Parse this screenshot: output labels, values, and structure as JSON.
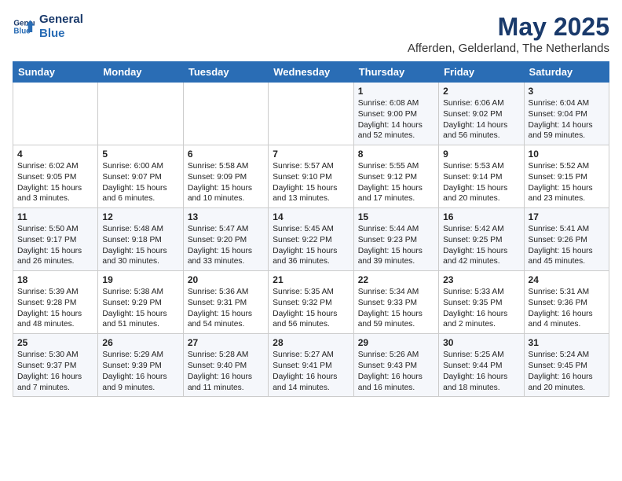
{
  "header": {
    "logo_line1": "General",
    "logo_line2": "Blue",
    "month": "May 2025",
    "location": "Afferden, Gelderland, The Netherlands"
  },
  "weekdays": [
    "Sunday",
    "Monday",
    "Tuesday",
    "Wednesday",
    "Thursday",
    "Friday",
    "Saturday"
  ],
  "weeks": [
    [
      {
        "day": "",
        "content": ""
      },
      {
        "day": "",
        "content": ""
      },
      {
        "day": "",
        "content": ""
      },
      {
        "day": "",
        "content": ""
      },
      {
        "day": "1",
        "content": "Sunrise: 6:08 AM\nSunset: 9:00 PM\nDaylight: 14 hours\nand 52 minutes."
      },
      {
        "day": "2",
        "content": "Sunrise: 6:06 AM\nSunset: 9:02 PM\nDaylight: 14 hours\nand 56 minutes."
      },
      {
        "day": "3",
        "content": "Sunrise: 6:04 AM\nSunset: 9:04 PM\nDaylight: 14 hours\nand 59 minutes."
      }
    ],
    [
      {
        "day": "4",
        "content": "Sunrise: 6:02 AM\nSunset: 9:05 PM\nDaylight: 15 hours\nand 3 minutes."
      },
      {
        "day": "5",
        "content": "Sunrise: 6:00 AM\nSunset: 9:07 PM\nDaylight: 15 hours\nand 6 minutes."
      },
      {
        "day": "6",
        "content": "Sunrise: 5:58 AM\nSunset: 9:09 PM\nDaylight: 15 hours\nand 10 minutes."
      },
      {
        "day": "7",
        "content": "Sunrise: 5:57 AM\nSunset: 9:10 PM\nDaylight: 15 hours\nand 13 minutes."
      },
      {
        "day": "8",
        "content": "Sunrise: 5:55 AM\nSunset: 9:12 PM\nDaylight: 15 hours\nand 17 minutes."
      },
      {
        "day": "9",
        "content": "Sunrise: 5:53 AM\nSunset: 9:14 PM\nDaylight: 15 hours\nand 20 minutes."
      },
      {
        "day": "10",
        "content": "Sunrise: 5:52 AM\nSunset: 9:15 PM\nDaylight: 15 hours\nand 23 minutes."
      }
    ],
    [
      {
        "day": "11",
        "content": "Sunrise: 5:50 AM\nSunset: 9:17 PM\nDaylight: 15 hours\nand 26 minutes."
      },
      {
        "day": "12",
        "content": "Sunrise: 5:48 AM\nSunset: 9:18 PM\nDaylight: 15 hours\nand 30 minutes."
      },
      {
        "day": "13",
        "content": "Sunrise: 5:47 AM\nSunset: 9:20 PM\nDaylight: 15 hours\nand 33 minutes."
      },
      {
        "day": "14",
        "content": "Sunrise: 5:45 AM\nSunset: 9:22 PM\nDaylight: 15 hours\nand 36 minutes."
      },
      {
        "day": "15",
        "content": "Sunrise: 5:44 AM\nSunset: 9:23 PM\nDaylight: 15 hours\nand 39 minutes."
      },
      {
        "day": "16",
        "content": "Sunrise: 5:42 AM\nSunset: 9:25 PM\nDaylight: 15 hours\nand 42 minutes."
      },
      {
        "day": "17",
        "content": "Sunrise: 5:41 AM\nSunset: 9:26 PM\nDaylight: 15 hours\nand 45 minutes."
      }
    ],
    [
      {
        "day": "18",
        "content": "Sunrise: 5:39 AM\nSunset: 9:28 PM\nDaylight: 15 hours\nand 48 minutes."
      },
      {
        "day": "19",
        "content": "Sunrise: 5:38 AM\nSunset: 9:29 PM\nDaylight: 15 hours\nand 51 minutes."
      },
      {
        "day": "20",
        "content": "Sunrise: 5:36 AM\nSunset: 9:31 PM\nDaylight: 15 hours\nand 54 minutes."
      },
      {
        "day": "21",
        "content": "Sunrise: 5:35 AM\nSunset: 9:32 PM\nDaylight: 15 hours\nand 56 minutes."
      },
      {
        "day": "22",
        "content": "Sunrise: 5:34 AM\nSunset: 9:33 PM\nDaylight: 15 hours\nand 59 minutes."
      },
      {
        "day": "23",
        "content": "Sunrise: 5:33 AM\nSunset: 9:35 PM\nDaylight: 16 hours\nand 2 minutes."
      },
      {
        "day": "24",
        "content": "Sunrise: 5:31 AM\nSunset: 9:36 PM\nDaylight: 16 hours\nand 4 minutes."
      }
    ],
    [
      {
        "day": "25",
        "content": "Sunrise: 5:30 AM\nSunset: 9:37 PM\nDaylight: 16 hours\nand 7 minutes."
      },
      {
        "day": "26",
        "content": "Sunrise: 5:29 AM\nSunset: 9:39 PM\nDaylight: 16 hours\nand 9 minutes."
      },
      {
        "day": "27",
        "content": "Sunrise: 5:28 AM\nSunset: 9:40 PM\nDaylight: 16 hours\nand 11 minutes."
      },
      {
        "day": "28",
        "content": "Sunrise: 5:27 AM\nSunset: 9:41 PM\nDaylight: 16 hours\nand 14 minutes."
      },
      {
        "day": "29",
        "content": "Sunrise: 5:26 AM\nSunset: 9:43 PM\nDaylight: 16 hours\nand 16 minutes."
      },
      {
        "day": "30",
        "content": "Sunrise: 5:25 AM\nSunset: 9:44 PM\nDaylight: 16 hours\nand 18 minutes."
      },
      {
        "day": "31",
        "content": "Sunrise: 5:24 AM\nSunset: 9:45 PM\nDaylight: 16 hours\nand 20 minutes."
      }
    ]
  ]
}
